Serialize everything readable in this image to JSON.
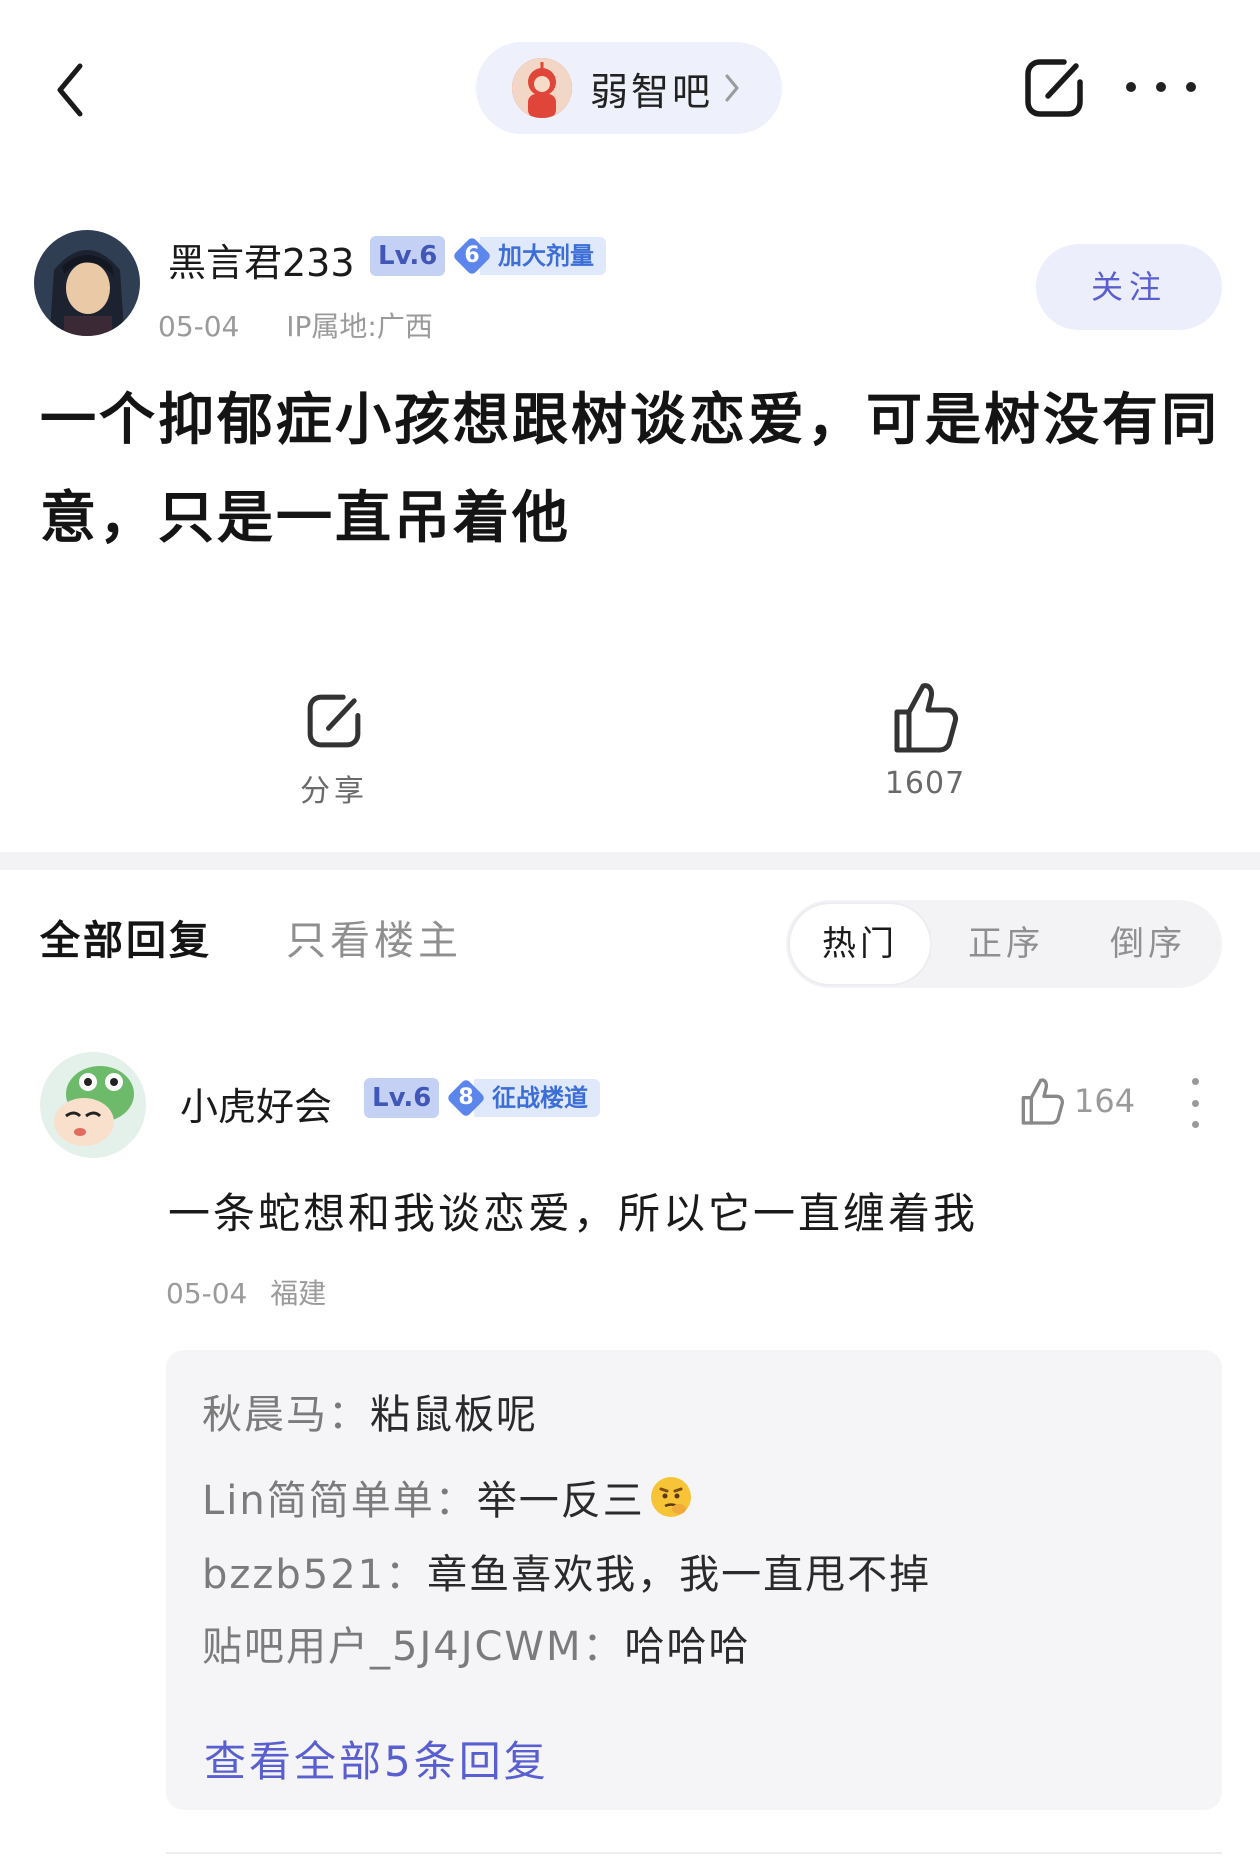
{
  "header": {
    "forum_name": "弱智吧"
  },
  "post": {
    "author": {
      "name": "黑言君233",
      "level": "Lv.6",
      "medal_number": "6",
      "medal_title": "加大剂量"
    },
    "date": "05-04",
    "ip_location": "IP属地:广西",
    "follow_label": "关注",
    "title": "一个抑郁症小孩想跟树谈恋爱，可是树没有同意，只是一直吊着他",
    "share_label": "分享",
    "like_count": "1607"
  },
  "reply_tabs": {
    "all_label": "全部回复",
    "op_only_label": "只看楼主",
    "sort_options": [
      "热门",
      "正序",
      "倒序"
    ],
    "active_sort": "热门"
  },
  "reply": {
    "author": {
      "name": "小虎好会",
      "level": "Lv.6",
      "medal_number": "8",
      "medal_title": "征战楼道"
    },
    "like_count": "164",
    "text": "一条蛇想和我谈恋爱，所以它一直缠着我",
    "date": "05-04",
    "location": "福建",
    "sub_replies": [
      {
        "user": "秋晨马：",
        "text": "粘鼠板呢"
      },
      {
        "user": "Lin简简单单：",
        "text": "举一反三"
      },
      {
        "user": "bzzb521：",
        "text": "章鱼喜欢我，我一直甩不掉"
      },
      {
        "user": "贴吧用户_5J4JCWM：",
        "text": "哈哈哈"
      }
    ],
    "view_all_label": "查看全部5条回复"
  },
  "colors": {
    "accent": "#5a5fd0",
    "level_badge_bg": "#c5d0f5",
    "medal_blue": "#5d86ec"
  },
  "icons": {
    "back": "chevron-left-icon",
    "forum_chevron": "chevron-right-icon",
    "share": "share-icon",
    "more": "more-dots-icon",
    "like": "thumbs-up-icon",
    "emoji": "thinking-face-emoji"
  }
}
